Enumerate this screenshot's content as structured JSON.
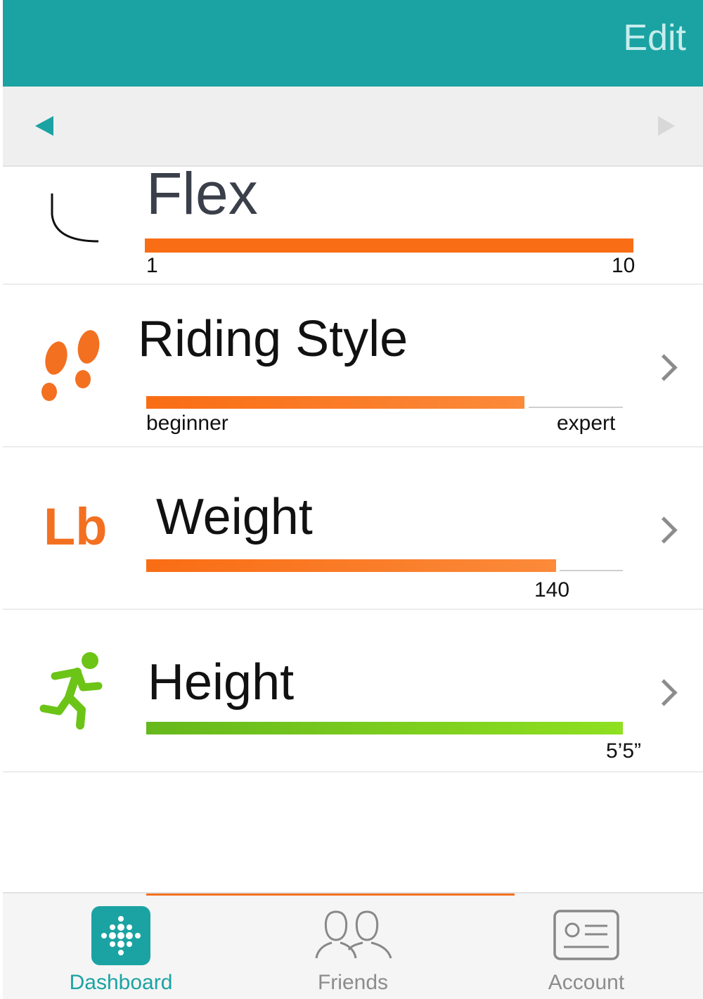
{
  "header": {
    "edit_label": "Edit"
  },
  "nav": {
    "prev_icon": "triangle-left-icon",
    "next_icon": "triangle-right-icon"
  },
  "colors": {
    "teal": "#1ba3a3",
    "orange": "#f37021",
    "green": "#79cc1e",
    "gray": "#8c8c8c"
  },
  "rows": [
    {
      "title": "Flex",
      "icon": "gauge-arc-icon",
      "min_label": "1",
      "max_label": "10",
      "fill_fraction": 1.0
    },
    {
      "title": "Riding Style",
      "icon": "footprints-icon",
      "min_label": "beginner",
      "max_label": "expert",
      "fill_fraction": 0.79
    },
    {
      "title": "Weight",
      "icon_text": "Lb",
      "value_label": "140",
      "fill_fraction": 0.86
    },
    {
      "title": "Height",
      "icon": "runner-icon",
      "value_label": "5’5”",
      "fill_fraction": 1.0
    }
  ],
  "tabs": [
    {
      "label": "Dashboard",
      "icon": "dashboard-dots-icon",
      "active": true
    },
    {
      "label": "Friends",
      "icon": "friends-icon",
      "active": false
    },
    {
      "label": "Account",
      "icon": "account-card-icon",
      "active": false
    }
  ]
}
